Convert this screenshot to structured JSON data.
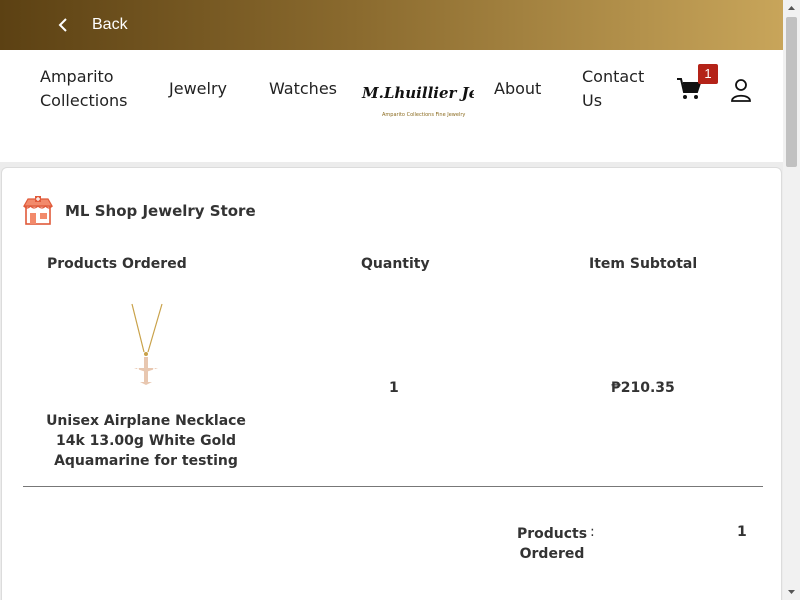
{
  "topbar": {
    "back_label": "Back",
    "gradient_start": "#5c4113",
    "gradient_end": "#c8a55a"
  },
  "nav": {
    "items": [
      "Amparito Collections",
      "Jewelry",
      "Watches",
      "About",
      "Contact Us"
    ],
    "logo_text": "M. Lhuillier Jewelers",
    "logo_tagline": "Amparito Collections Fine Jewelry",
    "cart_count": "1",
    "badge_color": "#b42318"
  },
  "store": {
    "name": "ML Shop Jewelry Store"
  },
  "table": {
    "headers": [
      "Products Ordered",
      "Quantity",
      "Item Subtotal"
    ],
    "rows": [
      {
        "product": "Unisex Airplane Necklace 14k 13.00g White Gold Aquamarine for testing",
        "quantity": "1",
        "subtotal": "₱210.35"
      }
    ]
  },
  "summary": {
    "label": "Products Ordered",
    "colon": ":",
    "value": "1"
  },
  "icons": [
    "chevron-left-icon",
    "cart-icon",
    "user-icon",
    "store-icon",
    "scroll-up-icon",
    "scroll-down-icon"
  ]
}
